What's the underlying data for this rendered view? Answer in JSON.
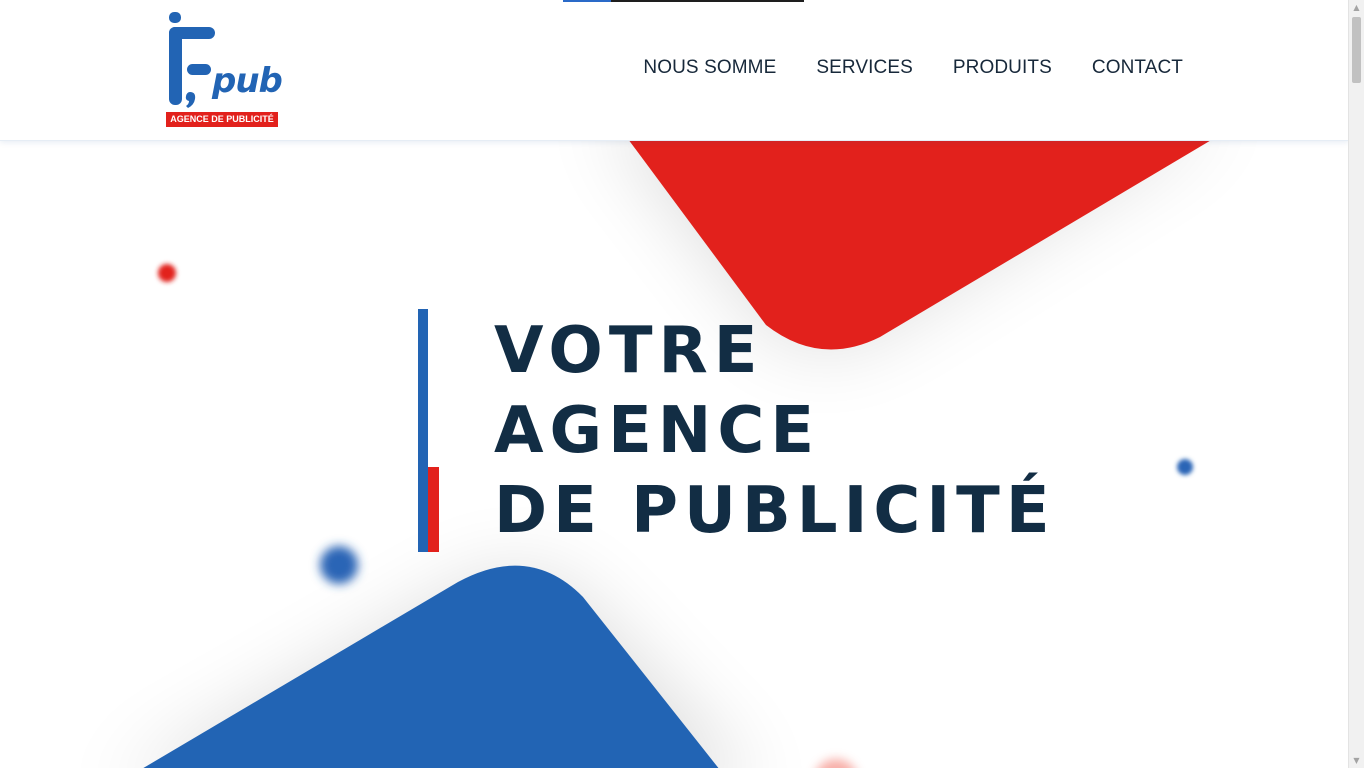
{
  "header": {
    "logo": {
      "brand_text": "pub",
      "tagline": "AGENCE DE PUBLICITÉ",
      "colors": {
        "blue": "#2264b4",
        "red": "#e2211c"
      }
    },
    "nav": [
      {
        "label": "NOUS SOMME"
      },
      {
        "label": "SERVICES"
      },
      {
        "label": "PRODUITS"
      },
      {
        "label": "CONTACT"
      }
    ]
  },
  "hero": {
    "headline": [
      "VOTRE",
      "AGENCE",
      "DE PUBLICITÉ"
    ],
    "colors": {
      "text": "#122d44",
      "accent_blue": "#2264b4",
      "accent_red": "#e2211c"
    }
  },
  "scrollbar": {
    "up_icon": "triangle-up-icon",
    "down_icon": "triangle-down-icon"
  }
}
